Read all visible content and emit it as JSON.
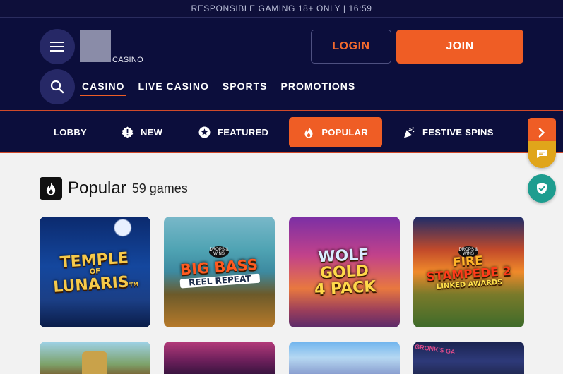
{
  "topbar": {
    "text": "RESPONSIBLE GAMING 18+ ONLY | 16:59"
  },
  "header": {
    "logo_text": "CASINO",
    "login_label": "LOGIN",
    "join_label": "JOIN"
  },
  "mainnav": [
    {
      "label": "CASINO"
    },
    {
      "label": "LIVE CASINO"
    },
    {
      "label": "SPORTS"
    },
    {
      "label": "PROMOTIONS"
    }
  ],
  "categories": [
    {
      "label": "LOBBY",
      "icon": "none"
    },
    {
      "label": "NEW",
      "icon": "badge-alert-icon"
    },
    {
      "label": "FEATURED",
      "icon": "star-circle-icon"
    },
    {
      "label": "POPULAR",
      "icon": "flame-icon"
    },
    {
      "label": "FESTIVE SPINS",
      "icon": "party-popper-icon"
    }
  ],
  "section": {
    "title": "Popular",
    "count": "59 games",
    "icon": "flame-icon"
  },
  "games": [
    {
      "title": "TEMPLE",
      "sub": "OF",
      "title2": "LUNARIS",
      "tm": "TM"
    },
    {
      "title": "BIG BASS",
      "sub": "REEL REPEAT",
      "badge": "DROPS & WINS"
    },
    {
      "title": "WOLF",
      "title2": "GOLD",
      "title3": "4 PACK"
    },
    {
      "title": "FIRE",
      "title2": "STAMPEDE 2",
      "sub": "LINKED AWARDS",
      "badge": "DROPS & WINS"
    }
  ],
  "games_row2": [
    {
      "label": ""
    },
    {
      "label": ""
    },
    {
      "label": ""
    },
    {
      "label": "GRONK'S GA"
    }
  ],
  "colors": {
    "accent": "#ef5d25",
    "navy": "#0c0e3c",
    "chat_fab": "#e0a51a",
    "shield_fab": "#1e9d8f"
  }
}
